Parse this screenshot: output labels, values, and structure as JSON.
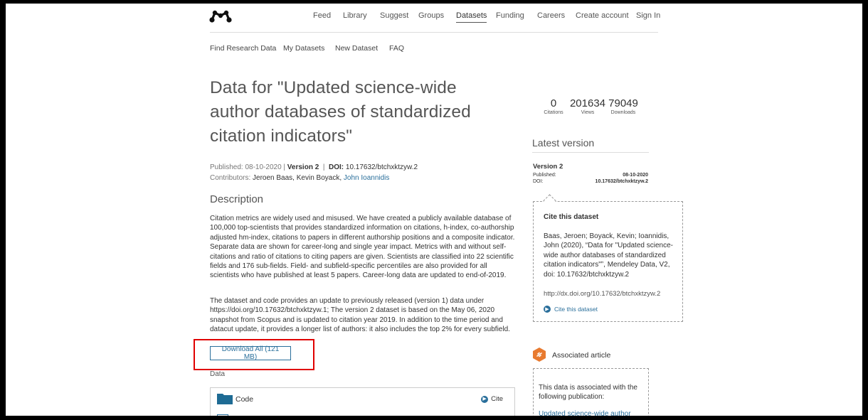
{
  "nav": {
    "items": [
      "Feed",
      "Library",
      "Suggest",
      "Groups",
      "Datasets",
      "Funding",
      "Careers",
      "Create account",
      "Sign In"
    ],
    "active": "Datasets"
  },
  "subnav": {
    "items": [
      "Find Research Data",
      "My Datasets",
      "New Dataset",
      "FAQ"
    ]
  },
  "dataset": {
    "title": "Data for \"Updated science-wide author databases of standardized citation indicators\"",
    "published_label": "Published: 08-10-2020 |",
    "version_label": "Version 2",
    "separator": "|",
    "doi_label": "DOI:",
    "doi_value": "10.17632/btchxktzyw.2",
    "contributors_label": "Contributors:",
    "contributors": [
      "Jeroen Baas,",
      "Kevin Boyack,"
    ],
    "contributor_link": "John Ioannidis"
  },
  "description": {
    "heading": "Description",
    "paragraph1": "Citation metrics are widely used and misused. We have created a publicly available database of 100,000 top-scientists that provides standardized information on citations, h-index, co-authorship adjusted hm-index, citations to papers in different authorship positions and a composite indicator. Separate data are shown for career-long and single year impact. Metrics with and without self-citations and ratio of citations to citing papers are given. Scientists are classified into 22 scientific fields and 176 sub-fields. Field- and subfield-specific percentiles are also provided for all scientists who have published at least 5 papers. Career-long data are updated to end-of-2019.",
    "paragraph2": "The dataset and code provides an update to previously released (version 1) data under https://doi.org/10.17632/btchxktzyw.1; The version 2 dataset is based on the May 06, 2020 snapshot from Scopus and is updated to citation year 2019. In addition to the time period and datacut update, it provides a longer list of authors: it also includes the top 2% for every subfield."
  },
  "download": {
    "label": "Download All (121 MB)"
  },
  "data_section": {
    "label": "Data",
    "folder_name": "Code",
    "cite_label": "Cite"
  },
  "stats": [
    {
      "value": "0",
      "label": "Citations"
    },
    {
      "value": "201634",
      "label": "Views"
    },
    {
      "value": "79049",
      "label": "Downloads"
    }
  ],
  "latest_version": {
    "heading": "Latest version",
    "version": "Version 2",
    "published_key": "Published:",
    "published_value": "08-10-2020",
    "doi_key": "DOI:",
    "doi_value": "10.17632/btchxktzyw.2"
  },
  "cite": {
    "title": "Cite this dataset",
    "text": "Baas, Jeroen; Boyack, Kevin; Ioannidis, John (2020), “Data for \"Updated science-wide author databases of standardized citation indicators\"”, Mendeley Data, V2, doi: 10.17632/btchxktzyw.2",
    "url": "http://dx.doi.org/10.17632/btchxktzyw.2",
    "link_label": "Cite this dataset"
  },
  "associated": {
    "heading": "Associated article",
    "text": "This data is associated with the following publication:",
    "link": "Updated science-wide author"
  },
  "colors": {
    "accent": "#2a6f9b",
    "highlight": "#e00000",
    "article_icon": "#e87a2f"
  }
}
